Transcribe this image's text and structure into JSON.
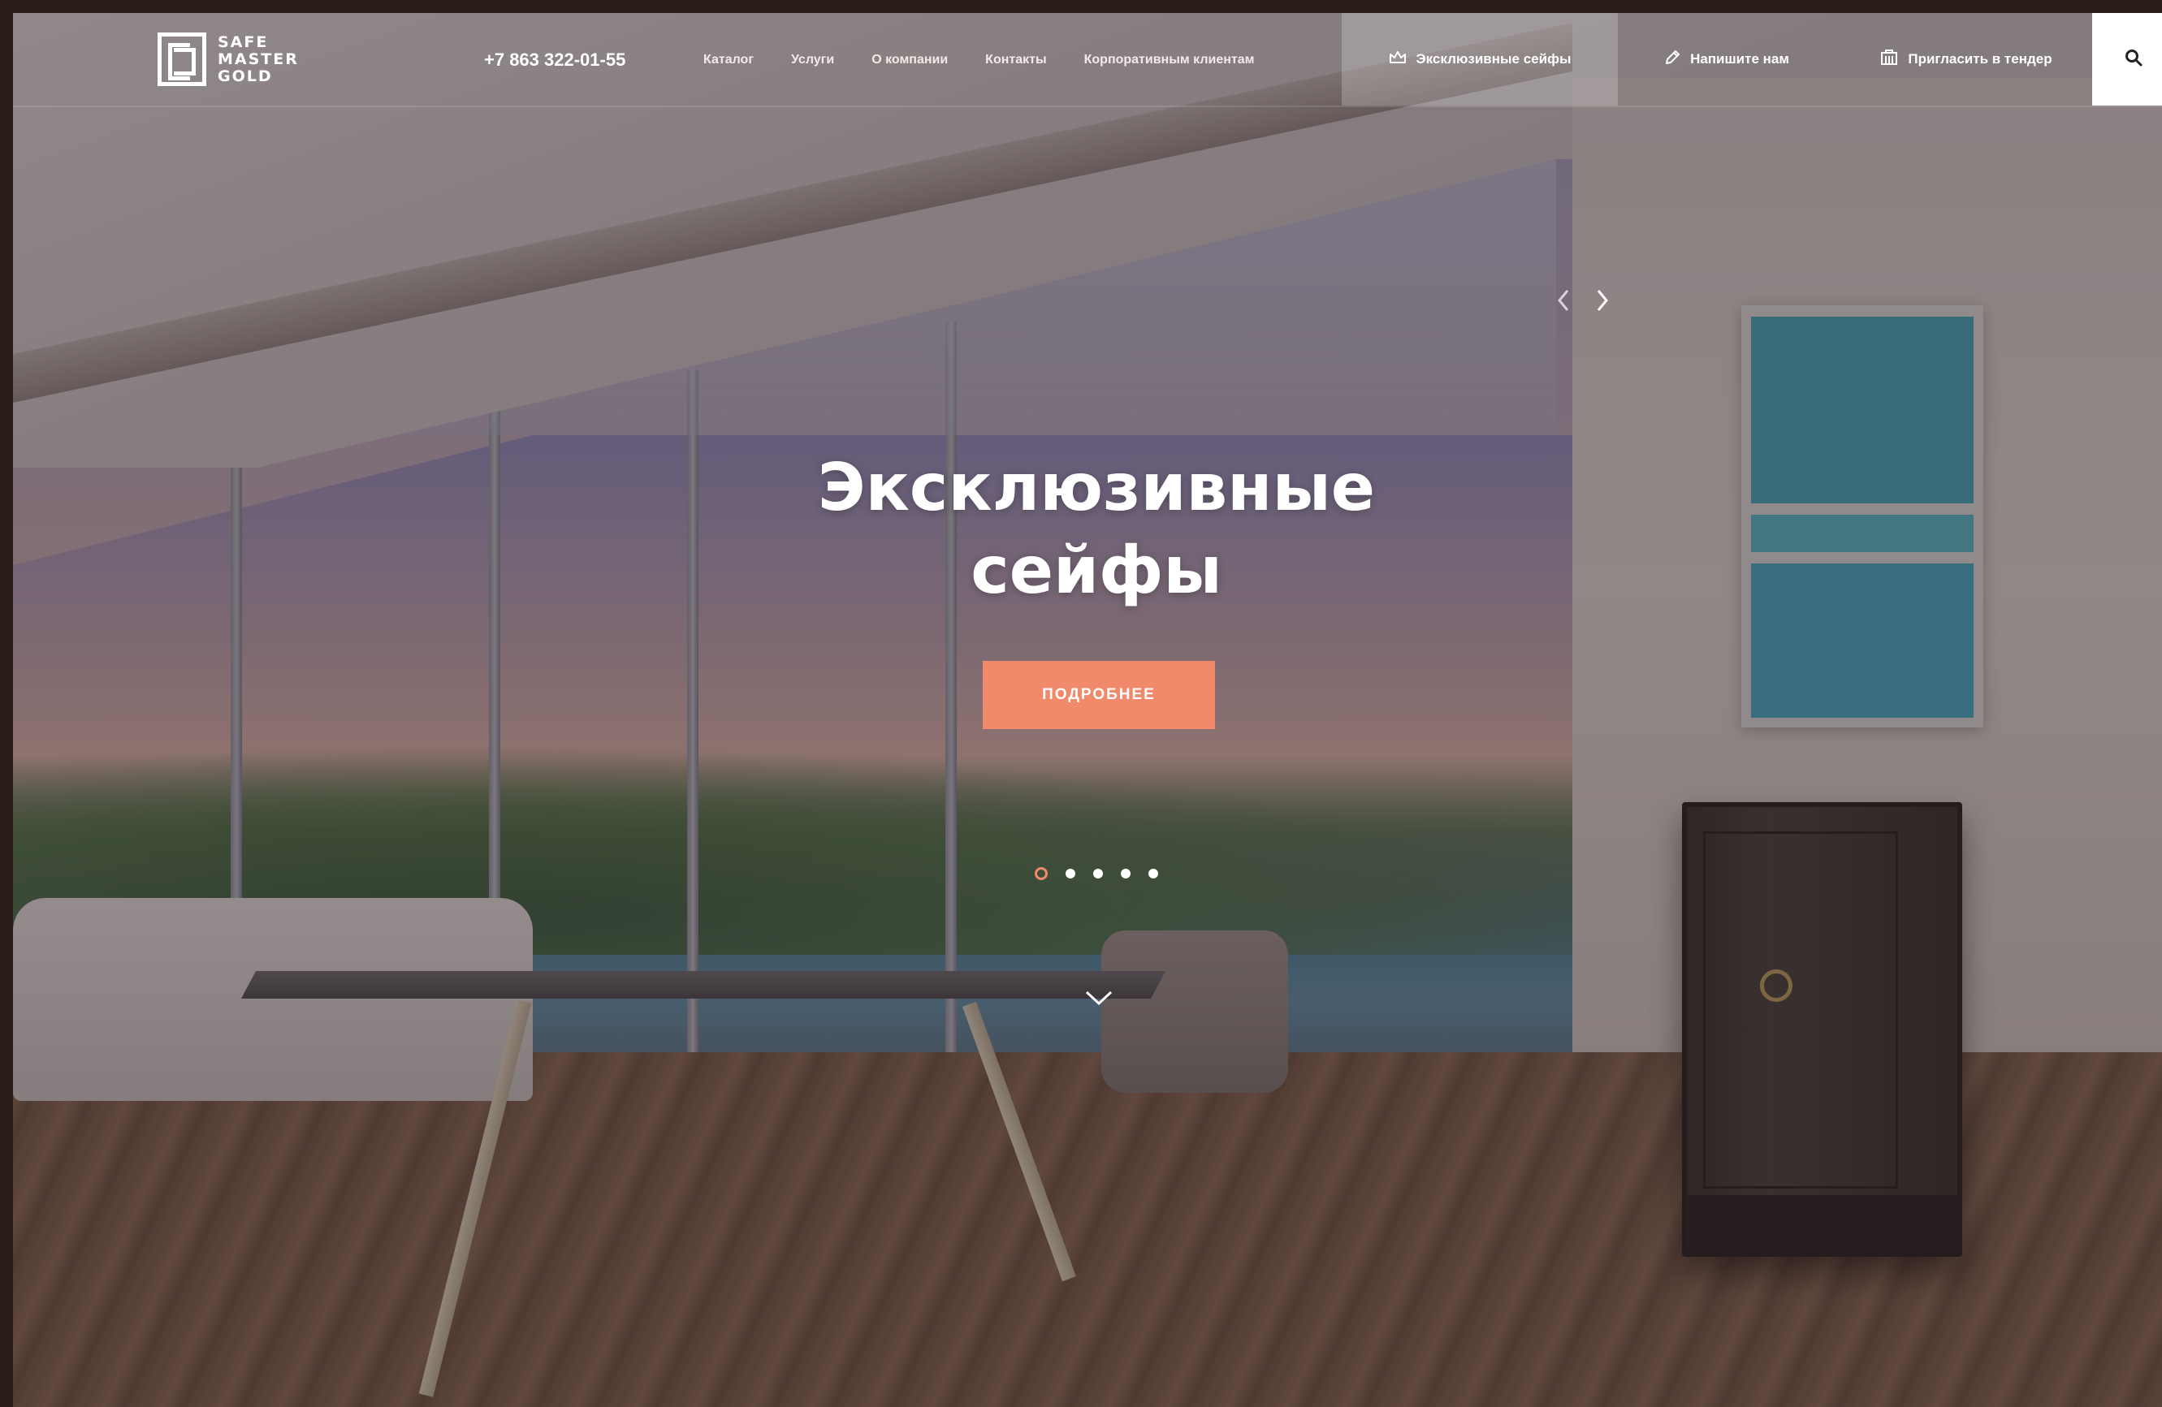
{
  "brand": {
    "logo_line1": "SAFE",
    "logo_line2": "MASTER",
    "logo_line3": "GOLD"
  },
  "header": {
    "phone": "+7 863 322-01-55",
    "nav": [
      {
        "label": "Каталог"
      },
      {
        "label": "Услуги"
      },
      {
        "label": "О компании"
      },
      {
        "label": "Контакты"
      },
      {
        "label": "Корпоративным клиентам"
      }
    ],
    "actions": {
      "exclusive": "Эксклюзивные сейфы",
      "write": "Напишите нам",
      "tender": "Пригласить в тендер"
    },
    "icons": {
      "exclusive": "crown-icon",
      "write": "pencil-icon",
      "tender": "building-icon",
      "search": "search-icon"
    }
  },
  "hero": {
    "title_line1": "Эксклюзивные",
    "title_line2": "сейфы",
    "button": "ПОДРОБНЕЕ",
    "slides_total": 5,
    "active_slide": 1
  },
  "colors": {
    "accent": "#f08a6b",
    "overlay": "#1e1216",
    "frame": "#2a1c18"
  }
}
